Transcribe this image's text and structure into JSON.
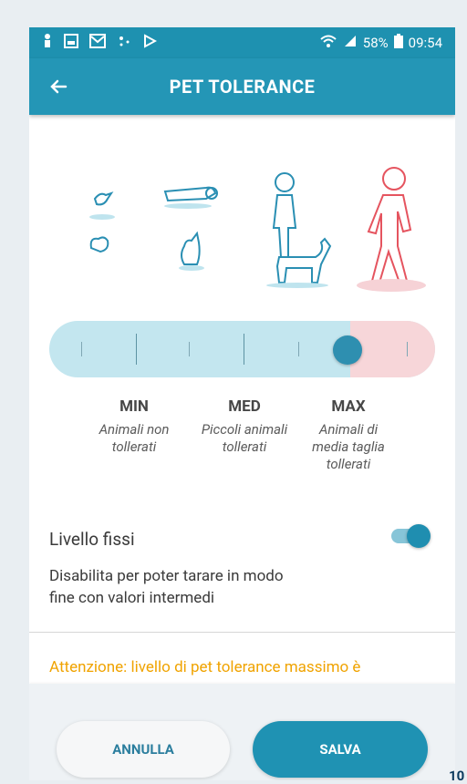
{
  "statusbar": {
    "battery_percent": "58%",
    "time": "09:54",
    "icons": [
      "person-icon",
      "gallery-icon",
      "mail-icon",
      "dots-icon",
      "play-icon",
      "wifi-icon",
      "signal-icon",
      "battery-icon"
    ]
  },
  "appbar": {
    "title": "PET TOLERANCE",
    "back_icon": "arrow-left-icon"
  },
  "illustrations": [
    "bird-and-small-pet-icon",
    "cat-and-lying-person-icon",
    "person-with-dog-icon",
    "walking-person-icon"
  ],
  "slider": {
    "selected_level": "MAX",
    "levels": [
      {
        "label": "MIN",
        "desc1": "Animali non",
        "desc2": "tollerati",
        "desc3": ""
      },
      {
        "label": "MED",
        "desc1": "Piccoli animali",
        "desc2": "tollerati",
        "desc3": ""
      },
      {
        "label": "MAX",
        "desc1": "Animali di",
        "desc2": "media taglia",
        "desc3": "tollerati"
      }
    ],
    "colors": {
      "track": "#c3e6ef",
      "danger": "#f7d6d9",
      "thumb": "#2e8fb0"
    }
  },
  "fixed_levels": {
    "label": "Livello fissi",
    "enabled": true,
    "desc_line1": "Disabilita per poter tarare in modo",
    "desc_line2": "fine con valori intermedi"
  },
  "warning": {
    "text": "Attenzione: livello di pet tolerance massimo è",
    "color": "#f0a300"
  },
  "footer": {
    "cancel_label": "ANNULLA",
    "save_label": "SALVA"
  },
  "page_number": "10"
}
